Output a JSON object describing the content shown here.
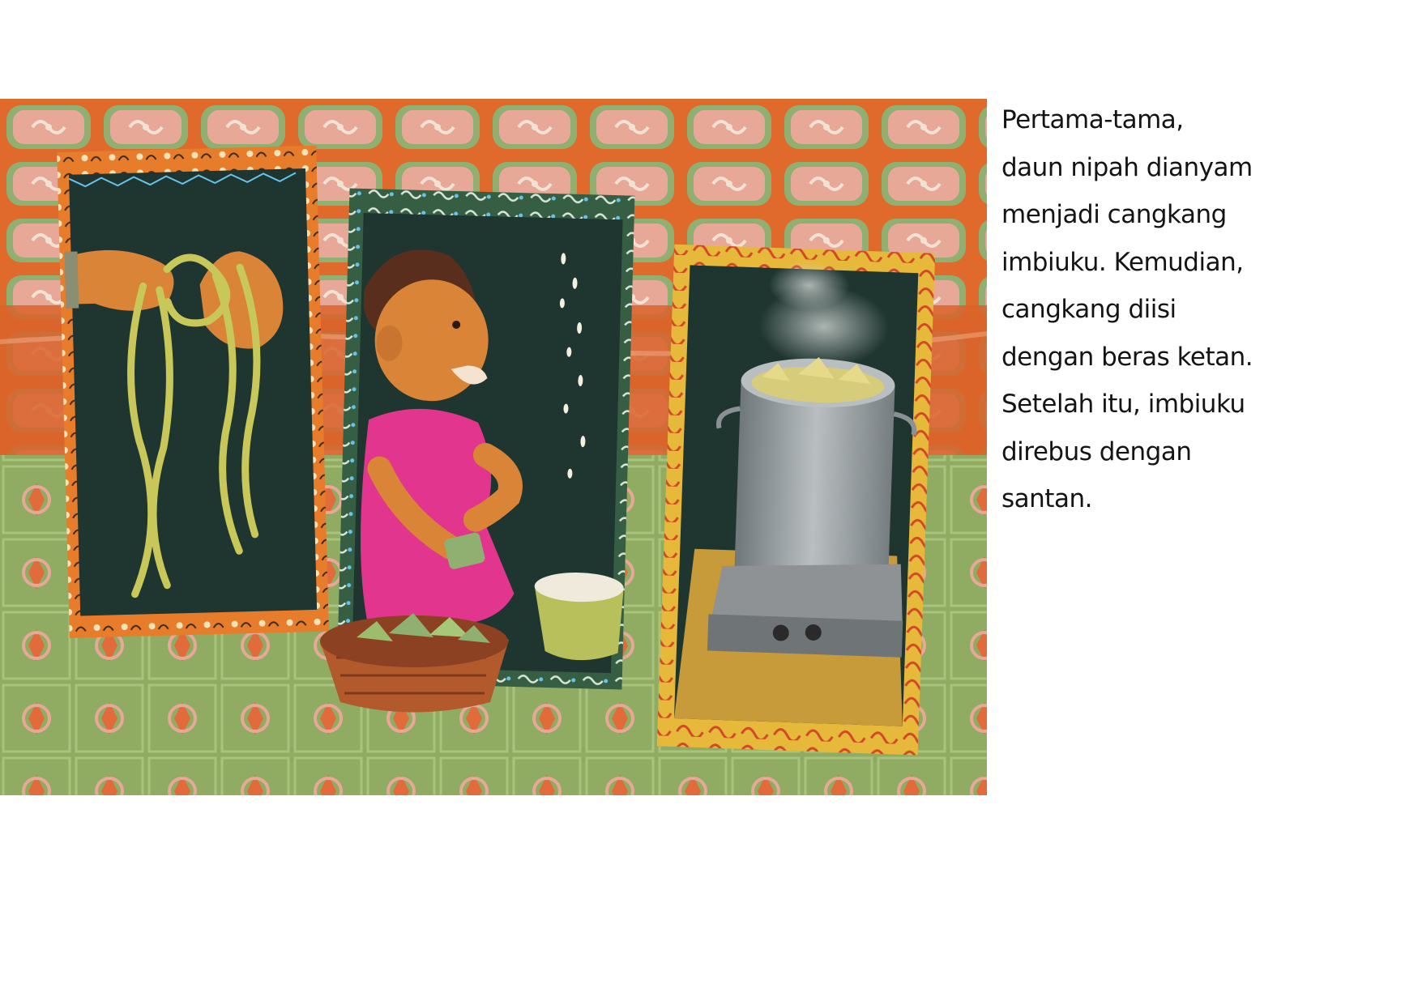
{
  "page": {
    "text_lines": [
      "Pertama-tama,",
      "daun nipah dianyam",
      "menjadi cangkang",
      "imbiuku. Kemudian,",
      "cangkang diisi",
      "dengan beras ketan.",
      "Setelah itu, imbiuku",
      "direbus dengan",
      "santan."
    ]
  },
  "colors": {
    "wall_orange": "#e06a2b",
    "wall_pink": "#e8a898",
    "wall_green": "#8fb070",
    "floor_green": "#8fac62",
    "panel_dark": "#1f3530",
    "frame_orange": "#e77c2a",
    "frame_green": "#355e42",
    "frame_yellow": "#e7b93a",
    "dress_pink": "#e2368e",
    "skin": "#d98436",
    "leaf": "#c8c85a",
    "pot": "#9ea3a6",
    "basket": "#b25a2c"
  }
}
